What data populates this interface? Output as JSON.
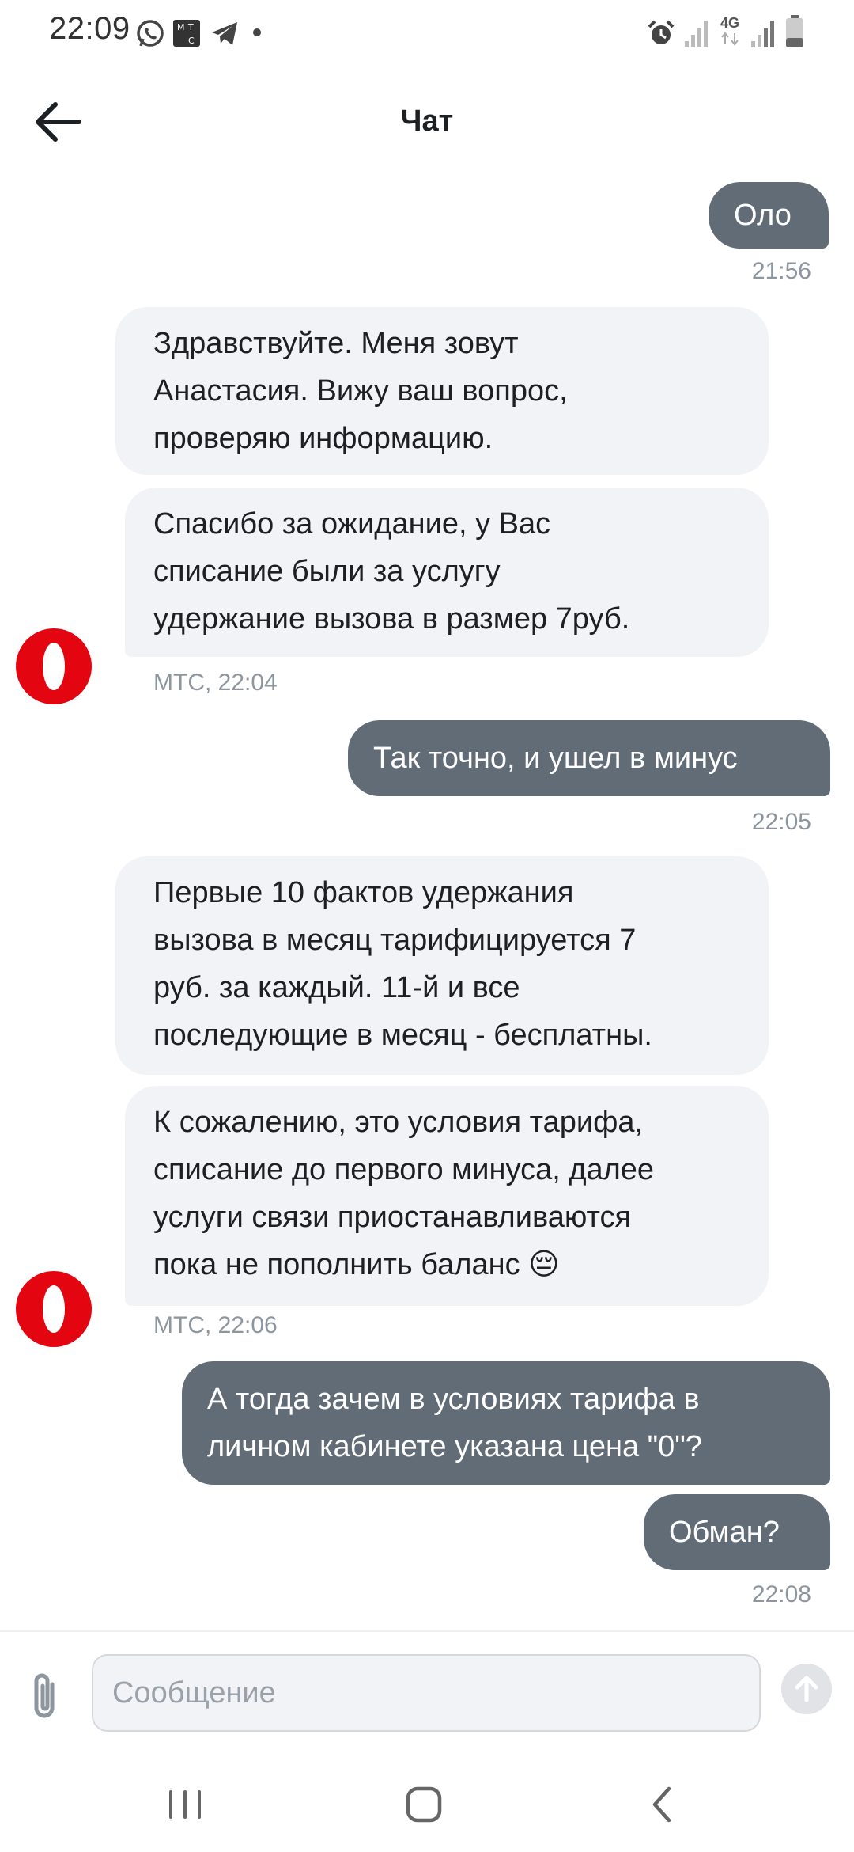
{
  "status_bar": {
    "time": "22:09",
    "icons_left": [
      "whatsapp-icon",
      "mts-app-icon",
      "telegram-icon",
      "dot-icon"
    ],
    "icons_right": [
      "alarm-icon",
      "signal-icon",
      "network-4g-icon",
      "signal-icon",
      "battery-icon"
    ],
    "network_label": "4G"
  },
  "header": {
    "title": "Чат",
    "back_icon": "arrow-left-icon"
  },
  "messages": [
    {
      "direction": "out",
      "lines": [
        "Оло"
      ],
      "time": "21:56"
    },
    {
      "direction": "in",
      "lines": [
        "Здравствуйте. Меня зовут",
        "Анастасия. Вижу ваш вопрос,",
        "проверяю информацию."
      ]
    },
    {
      "direction": "in",
      "lines": [
        "Спасибо за ожидание, у Вас",
        "списание были за услугу",
        "удержание вызова в размер 7руб."
      ],
      "meta": "МТС, 22:04"
    },
    {
      "direction": "out",
      "lines": [
        "Так точно, и ушел в минус"
      ],
      "time": "22:05"
    },
    {
      "direction": "in",
      "lines": [
        "Первые 10 фактов удержания",
        "вызова в месяц тарифицируется  7",
        "руб. за каждый. 11-й и все",
        "последующие в месяц - бесплатны."
      ]
    },
    {
      "direction": "in",
      "lines": [
        "К сожалению,  это условия тарифа,",
        "списание до первого минуса, далее",
        "услуги связи приостанавливаются",
        "пока не пополнить баланс"
      ],
      "emoji": "😔",
      "meta": "МТС, 22:06"
    },
    {
      "direction": "out",
      "lines": [
        "А тогда зачем в условиях тарифа в",
        "личном кабинете указана цена \"0\"?"
      ]
    },
    {
      "direction": "out",
      "lines": [
        "Обман?"
      ],
      "time": "22:08"
    }
  ],
  "input": {
    "placeholder": "Сообщение",
    "value": "",
    "attach_icon": "paperclip-icon",
    "send_icon": "send-arrow-up-icon"
  },
  "nav_bar": {
    "icons": [
      "recent-apps-icon",
      "home-icon",
      "back-icon"
    ]
  },
  "colors": {
    "outgoing_bubble": "#626c77",
    "incoming_bubble": "#f2f3f7",
    "brand_red": "#e30611",
    "meta_text": "#8d969f"
  }
}
